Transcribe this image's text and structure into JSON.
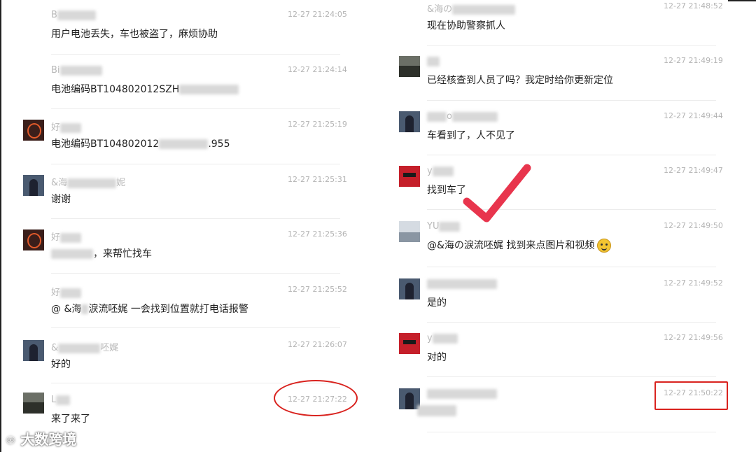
{
  "left_panel": {
    "messages": [
      {
        "name": "B",
        "time": "12-27 21:24:05",
        "text": "用户电池丢失，车也被盗了，麻烦协助",
        "avatar": "none"
      },
      {
        "name": "Bi",
        "time": "12-27 21:24:14",
        "text": "电池编码BT104802012SZH",
        "avatar": "none"
      },
      {
        "name": "好",
        "time": "12-27 21:25:19",
        "text": "电池编码BT104802012",
        "text_tail": ".955",
        "avatar": "brown-circle-icon"
      },
      {
        "name": "&海",
        "time": "12-27 21:25:31",
        "text": "谢谢",
        "avatar": "person-photo",
        "name_tail": "妮"
      },
      {
        "name": "好",
        "time": "12-27 21:25:36",
        "text": "，来帮忙找车",
        "avatar": "brown-circle-icon"
      },
      {
        "name": "好",
        "time": "12-27 21:25:52",
        "text": "@ &海",
        "text_tail": "淚流呸娓 一会找到位置就打电话报警",
        "avatar": "none"
      },
      {
        "name": "&",
        "time": "12-27 21:26:07",
        "text": "好的",
        "avatar": "person-photo",
        "name_tail": "呸娓"
      },
      {
        "name": "L",
        "time": "12-27 21:27:22",
        "text": "来了来了",
        "avatar": "scene-photo"
      }
    ]
  },
  "right_panel": {
    "messages": [
      {
        "name": "&海の",
        "time": "12-27 21:48:52",
        "text": "现在协助警察抓人",
        "avatar": "none"
      },
      {
        "name": "",
        "time": "12-27 21:49:19",
        "text": "已经核查到人员了吗？我定时给你更新定位",
        "avatar": "scene-photo"
      },
      {
        "name": "o",
        "time": "12-27 21:49:44",
        "text": "车看到了，人不见了",
        "avatar": "person-photo"
      },
      {
        "name": "y",
        "time": "12-27 21:49:47",
        "text": "找到车了",
        "avatar": "red-logo"
      },
      {
        "name": "YU",
        "time": "12-27 21:49:50",
        "text": "@&海の淚流呸娓 找到来点图片和视频",
        "avatar": "snow-photo",
        "emoji": "smiley-emoji"
      },
      {
        "name": "",
        "time": "12-27 21:49:52",
        "text": "是的",
        "avatar": "person-photo"
      },
      {
        "name": "y",
        "time": "12-27 21:49:56",
        "text": "对的",
        "avatar": "red-logo"
      },
      {
        "name": "",
        "time": "12-27 21:50:22",
        "text": "",
        "avatar": "person-photo"
      }
    ]
  },
  "watermark": "大数跨境",
  "colors": {
    "annotation_red": "#d9231f",
    "check_red": "#e8354d",
    "time_gray": "#b4b4b4",
    "divider": "#ececec"
  }
}
